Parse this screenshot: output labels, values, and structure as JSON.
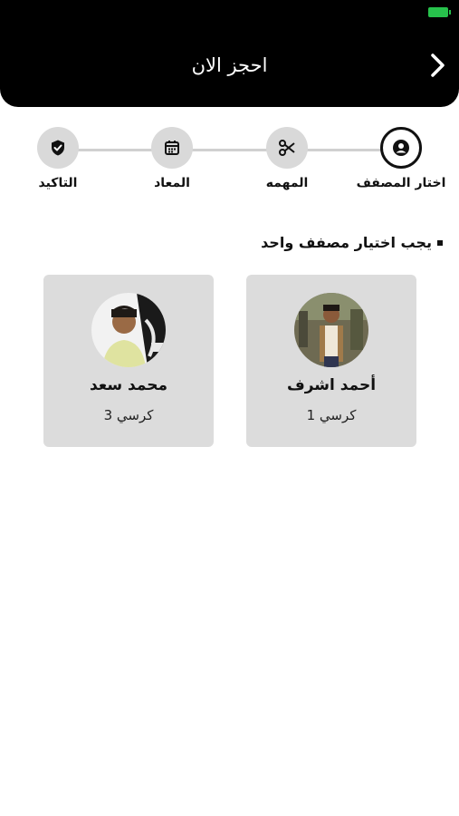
{
  "header": {
    "title": "احجز الان",
    "battery_color": "#27c24c"
  },
  "stepper": {
    "steps": [
      {
        "label": "اختار المصفف",
        "icon": "person-icon",
        "active": true
      },
      {
        "label": "المهمه",
        "icon": "scissors-icon",
        "active": false
      },
      {
        "label": "المعاد",
        "icon": "calendar-icon",
        "active": false
      },
      {
        "label": "التاكيد",
        "icon": "shield-check-icon",
        "active": false
      }
    ]
  },
  "note": "يجب اختيار مصفف واحد",
  "barbers": [
    {
      "name": "أحمد اشرف",
      "seat": "كرسي 1",
      "avatar": "avatar-photo-1"
    },
    {
      "name": "محمد سعد",
      "seat": "كرسي 3",
      "avatar": "avatar-photo-2"
    }
  ]
}
